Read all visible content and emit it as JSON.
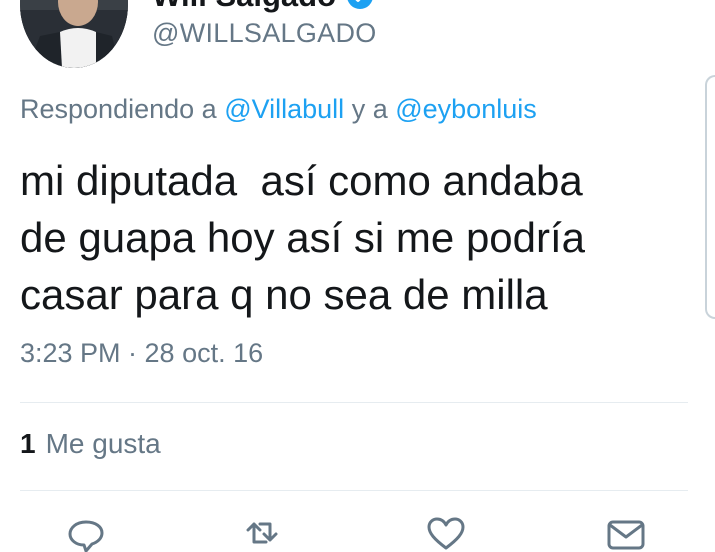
{
  "tweet": {
    "display_name": "Will Salgado",
    "handle": "@WILLSALGADO",
    "replying": {
      "prefix": "Respondiendo a",
      "mention_1": "@Villabull",
      "connector": "y a",
      "mention_2": "@eybonluis"
    },
    "text_lines": [
      "mi diputada  así como andaba",
      "de guapa hoy así si me podría",
      "casar para q no sea de milla"
    ],
    "timestamp": "3:23 PM · 28 oct. 16",
    "likes_count": "1",
    "likes_label": "Me gusta"
  },
  "icons": {
    "verified": "verified-badge-icon",
    "reply": "reply-icon",
    "retweet": "retweet-icon",
    "like": "heart-icon",
    "message": "envelope-icon"
  },
  "colors": {
    "text": "#14171a",
    "secondary": "#657786",
    "link": "#1da1f2",
    "divider": "#e6ecf0"
  }
}
